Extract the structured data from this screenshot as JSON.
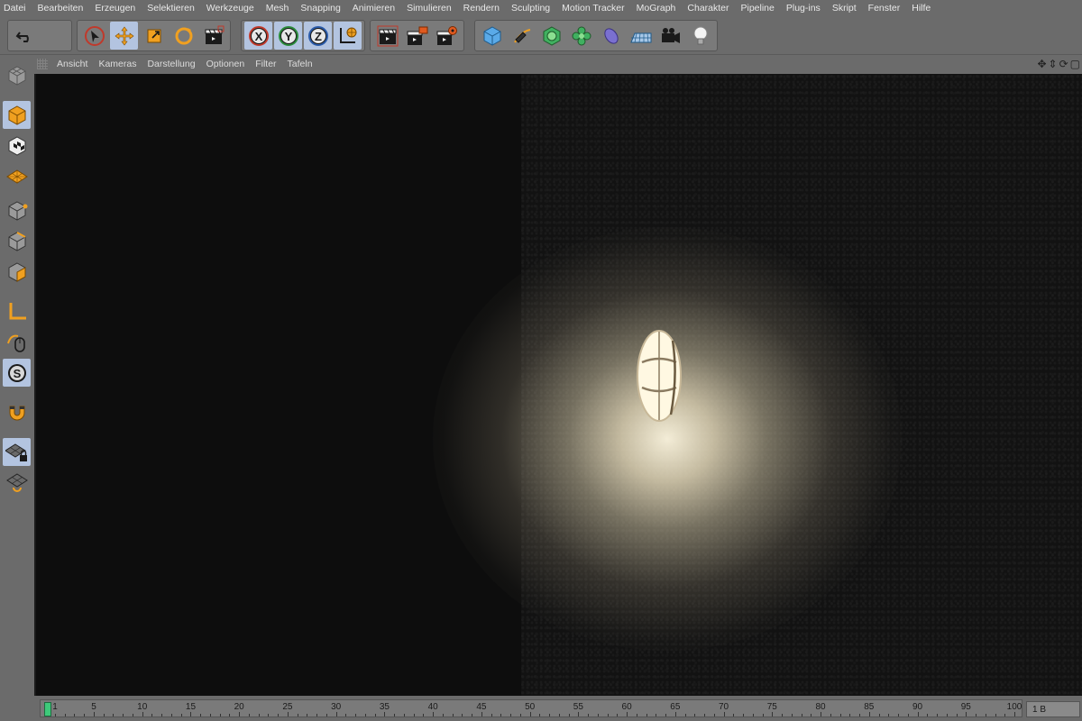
{
  "menu": [
    "Datei",
    "Bearbeiten",
    "Erzeugen",
    "Selektieren",
    "Werkzeuge",
    "Mesh",
    "Snapping",
    "Animieren",
    "Simulieren",
    "Rendern",
    "Sculpting",
    "Motion Tracker",
    "MoGraph",
    "Charakter",
    "Pipeline",
    "Plug-ins",
    "Skript",
    "Fenster",
    "Hilfe"
  ],
  "toolbar": {
    "axis_x": "X",
    "axis_y": "Y",
    "axis_z": "Z"
  },
  "viewport_menu": [
    "Ansicht",
    "Kameras",
    "Darstellung",
    "Optionen",
    "Filter",
    "Tafeln"
  ],
  "palette": {
    "snap_label": "S"
  },
  "timeline": {
    "ticks": [
      "1",
      "5",
      "10",
      "15",
      "20",
      "25",
      "30",
      "35",
      "40",
      "45",
      "50",
      "55",
      "60",
      "65",
      "70",
      "75",
      "80",
      "85",
      "90",
      "95",
      "100"
    ],
    "current_frame": "1 B"
  },
  "colors": {
    "accent_active": "#b3c4e0",
    "icon_orange": "#f0a020",
    "playhead": "#3ec97a"
  }
}
